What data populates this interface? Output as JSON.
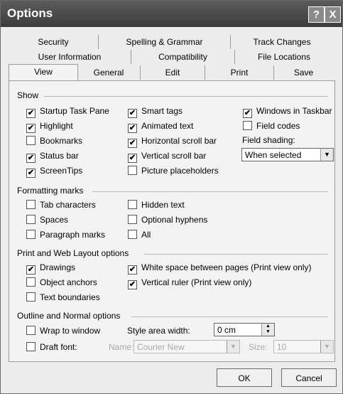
{
  "window": {
    "title": "Options",
    "help_glyph": "?",
    "close_glyph": "X"
  },
  "tabs": {
    "row1": [
      "Security",
      "Spelling & Grammar",
      "Track Changes"
    ],
    "row2": [
      "User Information",
      "Compatibility",
      "File Locations"
    ],
    "row3": [
      "View",
      "General",
      "Edit",
      "Print",
      "Save"
    ],
    "selected": "View"
  },
  "show": {
    "heading": "Show",
    "items": [
      {
        "label": "Startup Task Pane",
        "checked": true
      },
      {
        "label": "Highlight",
        "checked": true
      },
      {
        "label": "Bookmarks",
        "checked": false
      },
      {
        "label": "Status bar",
        "checked": true
      },
      {
        "label": "ScreenTips",
        "checked": true
      },
      {
        "label": "Smart tags",
        "checked": true
      },
      {
        "label": "Animated text",
        "checked": true
      },
      {
        "label": "Horizontal scroll bar",
        "checked": true
      },
      {
        "label": "Vertical scroll bar",
        "checked": true
      },
      {
        "label": "Picture placeholders",
        "checked": false
      },
      {
        "label": "Windows in Taskbar",
        "checked": true
      },
      {
        "label": "Field codes",
        "checked": false
      }
    ],
    "field_shading_label": "Field shading:",
    "field_shading_value": "When selected"
  },
  "formatting": {
    "heading": "Formatting marks",
    "items": [
      {
        "label": "Tab characters",
        "checked": false
      },
      {
        "label": "Spaces",
        "checked": false
      },
      {
        "label": "Paragraph marks",
        "checked": false
      },
      {
        "label": "Hidden text",
        "checked": false
      },
      {
        "label": "Optional hyphens",
        "checked": false
      },
      {
        "label": "All",
        "checked": false
      }
    ]
  },
  "print_web": {
    "heading": "Print and Web Layout options",
    "items": [
      {
        "label": "Drawings",
        "checked": true
      },
      {
        "label": "Object anchors",
        "checked": false
      },
      {
        "label": "Text boundaries",
        "checked": false
      },
      {
        "label": "White space between pages (Print view only)",
        "checked": true
      },
      {
        "label": "Vertical ruler (Print view only)",
        "checked": true
      }
    ]
  },
  "outline": {
    "heading": "Outline and Normal options",
    "wrap_label": "Wrap to window",
    "wrap_checked": false,
    "draft_label": "Draft font:",
    "draft_checked": false,
    "style_area_label": "Style area width:",
    "style_area_value": "0 cm",
    "name_label": "Name:",
    "name_value": "Courier New",
    "size_label": "Size:",
    "size_value": "10"
  },
  "buttons": {
    "ok": "OK",
    "cancel": "Cancel"
  }
}
